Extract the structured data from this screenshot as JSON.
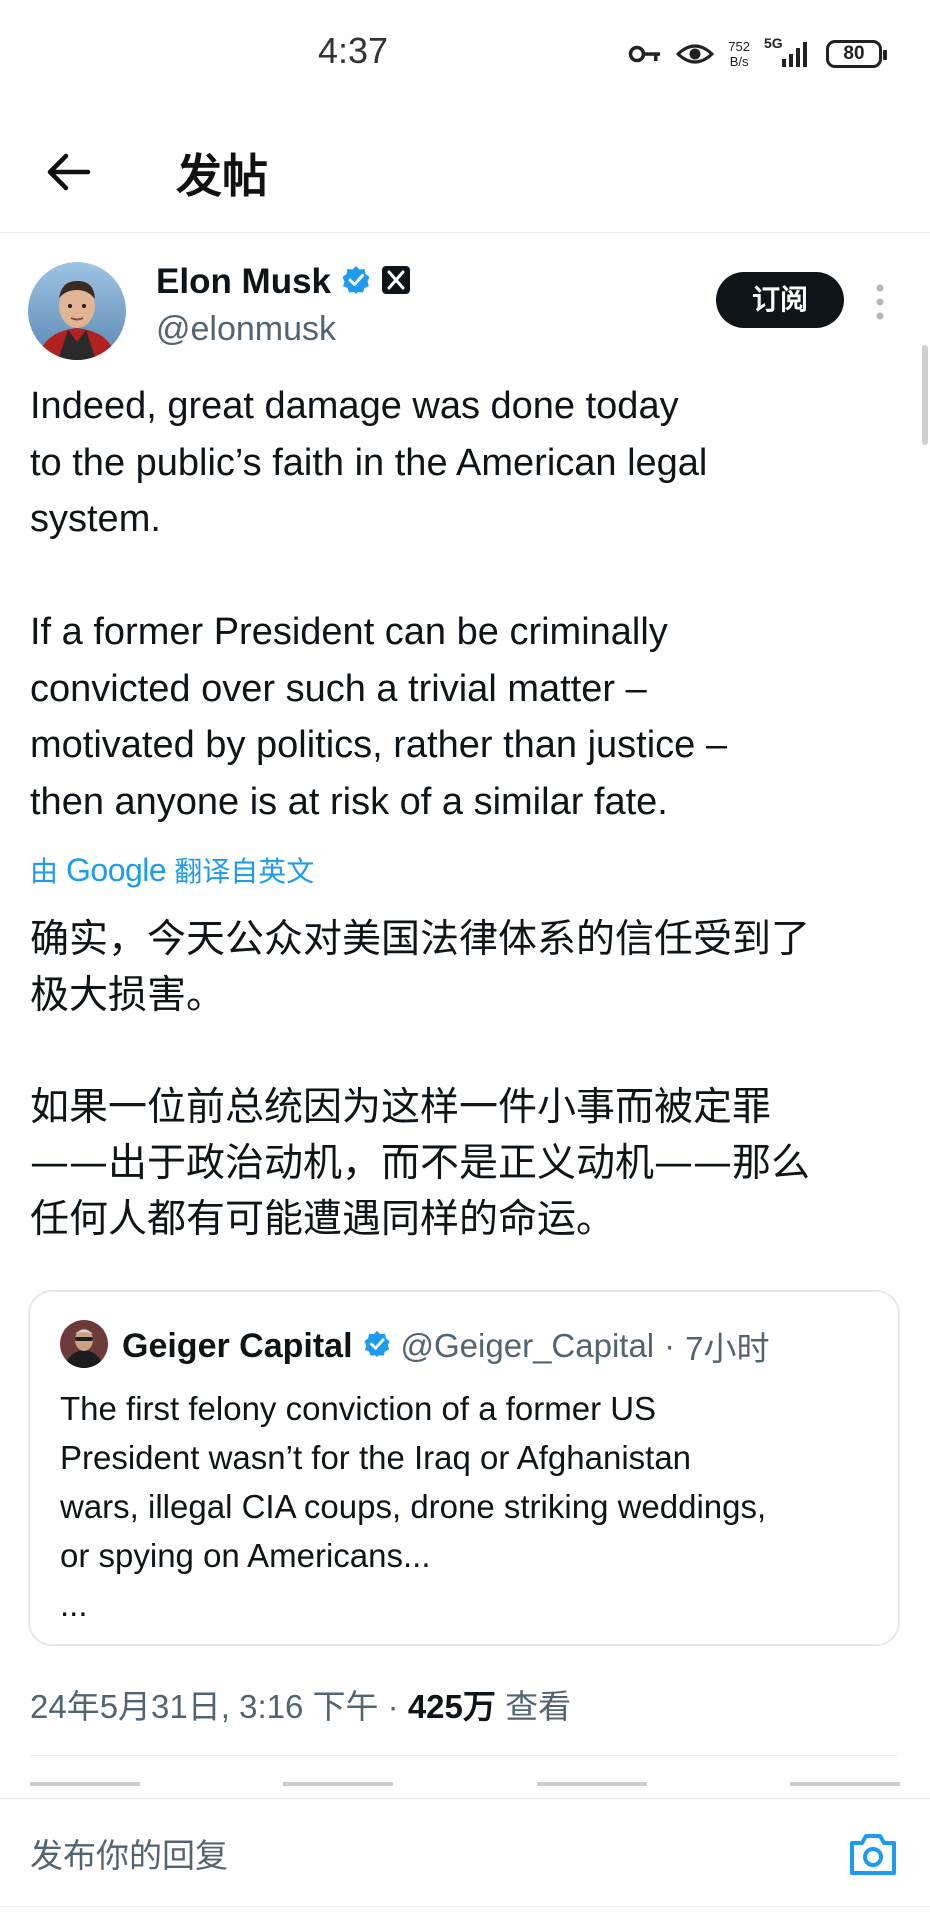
{
  "status_bar": {
    "time": "4:37",
    "net_speed_value": "752",
    "net_speed_unit": "B/s",
    "network": "5G",
    "battery": "80"
  },
  "header": {
    "title": "发帖"
  },
  "post": {
    "author_name": "Elon Musk",
    "author_handle": "@elonmusk",
    "subscribe_label": "订阅",
    "text_en": "Indeed, great damage was done today\nto the public’s faith in the American legal\nsystem.\n\nIf a former President can be criminally\nconvicted over such a trivial matter –\nmotivated by politics, rather than justice –\nthen anyone is at risk of a similar fate.",
    "translate_prefix": "由",
    "translate_brand": "Google",
    "translate_suffix": "翻译自英文",
    "text_zh": "确实，今天公众对美国法律体系的信任受到了\n极大损害。\n\n如果一位前总统因为这样一件小事而被定罪\n——出于政治动机，而不是正义动机——那么\n任何人都有可能遭遇同样的命运。",
    "date": "24年5月31日, 3:16 下午 ·",
    "views_count": "425万",
    "views_label": "查看"
  },
  "quote": {
    "name": "Geiger Capital",
    "handle": "@Geiger_Capital",
    "separator": "·",
    "time": "7小时",
    "text": "The first felony conviction of a former US\nPresident wasn’t for the Iraq or Afghanistan\nwars, illegal CIA coups, drone striking weddings,\nor spying on Americans...\n..."
  },
  "reply_bar": {
    "placeholder": "发布你的回复"
  },
  "colors": {
    "accent": "#1d9bf0",
    "text_primary": "#0f1419",
    "text_secondary": "#536471",
    "button_dark": "#0f1419"
  },
  "icons": [
    "back-arrow-icon",
    "verified-badge-icon",
    "x-logo-icon",
    "more-vertical-icon",
    "camera-icon",
    "key-icon",
    "eye-icon",
    "signal-icon",
    "battery-icon"
  ]
}
